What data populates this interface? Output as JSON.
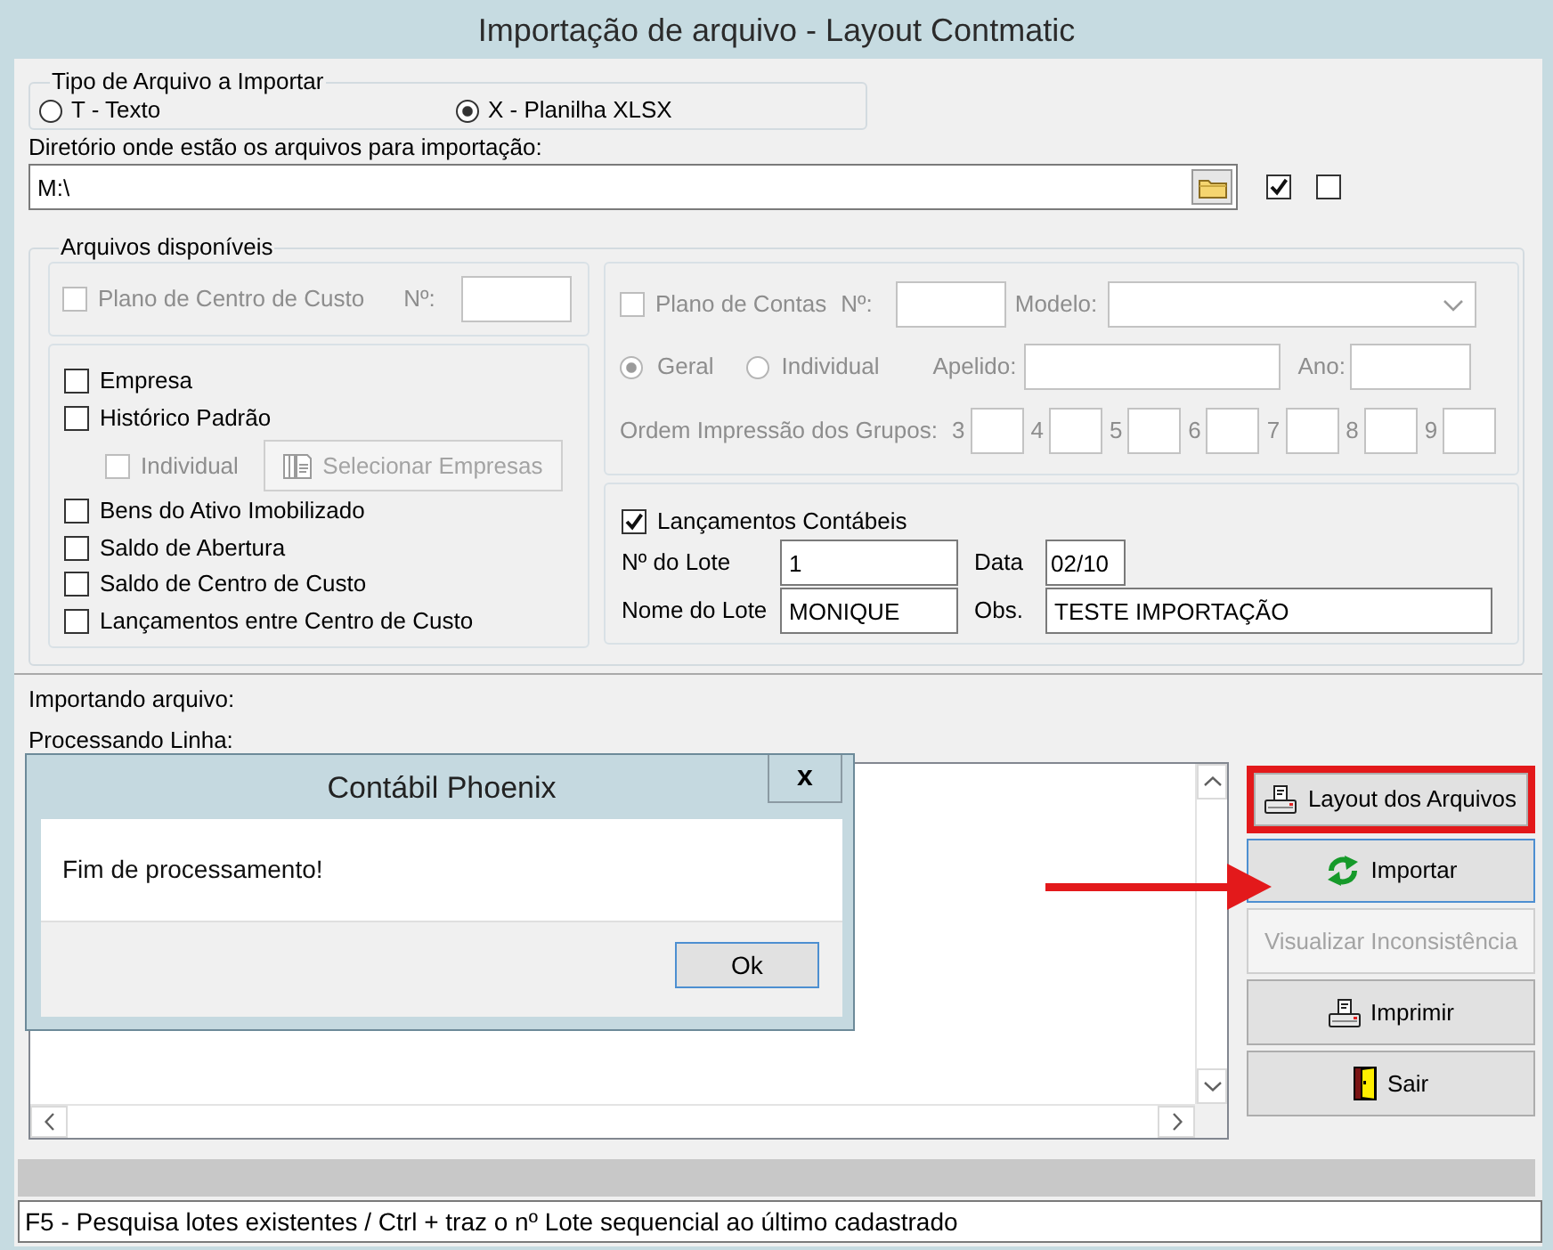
{
  "window": {
    "title": "Importação de arquivo - Layout Contmatic"
  },
  "file_type": {
    "legend": "Tipo de Arquivo a Importar",
    "options": [
      {
        "label": "T - Texto",
        "selected": false
      },
      {
        "label": "X - Planilha XLSX",
        "selected": true
      }
    ]
  },
  "directory": {
    "label": "Diretório onde estão os arquivos para importação:",
    "value": "M:\\",
    "options": [
      {
        "checked": true
      },
      {
        "checked": false
      }
    ]
  },
  "available_files": {
    "legend": "Arquivos disponíveis",
    "cost_center_plan": {
      "label": "Plano de Centro de Custo",
      "checked": false,
      "disabled": true,
      "number_label": "Nº:"
    },
    "items": [
      {
        "kind": "checkbox",
        "label": "Empresa",
        "checked": false,
        "disabled": false
      },
      {
        "kind": "checkbox",
        "label": "Histórico Padrão",
        "checked": false,
        "disabled": false
      },
      {
        "kind": "company_selection",
        "label": "Individual",
        "checked": false,
        "disabled": true,
        "button": {
          "label": "Selecionar Empresas",
          "disabled": true
        }
      },
      {
        "kind": "checkbox",
        "label": "Bens do Ativo Imobilizado",
        "checked": false,
        "disabled": false
      },
      {
        "kind": "checkbox",
        "label": "Saldo de Abertura",
        "checked": false,
        "disabled": false
      },
      {
        "kind": "checkbox",
        "label": "Saldo de Centro de Custo",
        "checked": false,
        "disabled": false
      },
      {
        "kind": "checkbox",
        "label": "Lançamentos entre Centro de Custo",
        "checked": false,
        "disabled": false
      }
    ],
    "chart_of_accounts": {
      "label": "Plano de Contas",
      "checked": false,
      "disabled": true,
      "number_label": "Nº:",
      "model_label": "Modelo:",
      "scope": [
        {
          "label": "Geral",
          "selected": true
        },
        {
          "label": "Individual",
          "selected": false
        }
      ],
      "nickname_label": "Apelido:",
      "year_label": "Ano:",
      "group_order_label": "Ordem Impressão dos Grupos:",
      "group_slots": [
        "3",
        "4",
        "5",
        "6",
        "7",
        "8",
        "9"
      ]
    },
    "entries": {
      "label": "Lançamentos Contábeis",
      "checked": true,
      "fields": [
        {
          "label": "Nº do Lote",
          "value": "1"
        },
        {
          "label": "Data",
          "value": "02/10"
        },
        {
          "label": "Nome do Lote",
          "value": "MONIQUE"
        },
        {
          "label": "Obs.",
          "value": "TESTE IMPORTAÇÃO"
        }
      ]
    }
  },
  "progress": {
    "importing_label": "Importando arquivo:",
    "processing_label": "Processando Linha:"
  },
  "buttons": [
    {
      "kind": "layout",
      "label": "Layout dos Arquivos",
      "highlighted": true,
      "focused": false,
      "disabled": false
    },
    {
      "kind": "import",
      "label": "Importar",
      "highlighted": false,
      "focused": true,
      "disabled": false
    },
    {
      "kind": "inconsistency",
      "label": "Visualizar Inconsistência",
      "highlighted": false,
      "focused": false,
      "disabled": true
    },
    {
      "kind": "print",
      "label": "Imprimir",
      "highlighted": false,
      "focused": false,
      "disabled": false
    },
    {
      "kind": "exit",
      "label": "Sair",
      "highlighted": false,
      "focused": false,
      "disabled": false
    }
  ],
  "dialog": {
    "title": "Contábil Phoenix",
    "close": "x",
    "message": "Fim de processamento!",
    "button": "Ok"
  },
  "status_bar": {
    "hint": "F5 - Pesquisa lotes existentes / Ctrl + traz o nº Lote sequencial ao último cadastrado"
  }
}
